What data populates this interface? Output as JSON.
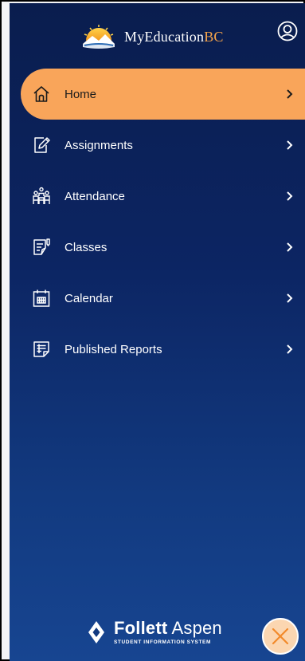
{
  "brand": {
    "name_main": "MyEducation",
    "name_accent": "BC",
    "logo_icon": "mountain-sun-logo",
    "accent_color": "#f6a44a"
  },
  "header": {
    "profile_icon": "user-circle-icon"
  },
  "nav": {
    "items": [
      {
        "label": "Home",
        "icon": "house-icon",
        "active": true
      },
      {
        "label": "Assignments",
        "icon": "edit-document-icon",
        "active": false
      },
      {
        "label": "Attendance",
        "icon": "people-group-icon",
        "active": false
      },
      {
        "label": "Classes",
        "icon": "class-list-icon",
        "active": false
      },
      {
        "label": "Calendar",
        "icon": "calendar-icon",
        "active": false
      },
      {
        "label": "Published Reports",
        "icon": "report-icon",
        "active": false
      }
    ],
    "active_color": "#f9a55a"
  },
  "footer": {
    "brand_bold": "Follett",
    "brand_regular": " Aspen",
    "tagline": "STUDENT INFORMATION SYSTEM"
  },
  "close_button": {
    "icon": "close-icon",
    "color": "#fbd6b1"
  }
}
